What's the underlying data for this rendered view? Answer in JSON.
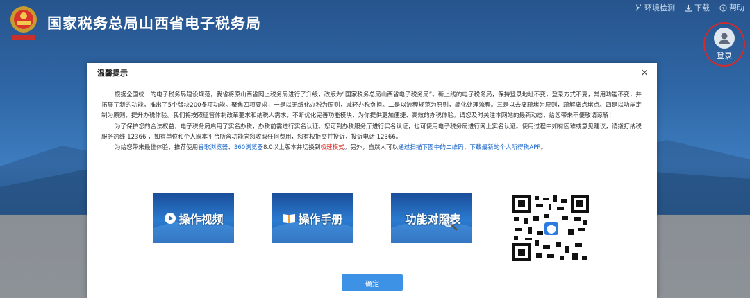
{
  "header": {
    "site_title": "国家税务总局山西省电子税务局",
    "links": [
      {
        "icon": "env-check-icon",
        "label": "环境检测"
      },
      {
        "icon": "download-icon",
        "label": "下载"
      },
      {
        "icon": "help-icon",
        "label": "帮助"
      }
    ],
    "login_label": "登录"
  },
  "modal": {
    "title": "温馨提示",
    "close_glyph": "×",
    "paragraph1": "根据全国统一的电子税务局建设规范，我省将原山西省网上税务局进行了升级，改版为“国家税务总局山西省电子税务局”。新上线的电子税务局，保持登录地址不变，登录方式不变，常用功能不变，并拓展了新的功能，推出了5个版块200多项功能。聚焦四项要求，一是以无纸化办税为原则，减轻办税负担。二是以流程规范为原则，简化处理流程。三是以去痛疏堵为原则，疏解痛点堵点。四是以功能定制为原则，提升办税体验。我们将按照征管体制改革要求和纳税人需求，不断优化完善功能模块，为你提供更加便捷、高效的办税体验。请您及时关注本网站的最新动态，给您带来不便敬请谅解！",
    "paragraph2": "为了保护您的合法权益，电子税务局启用了实名办税，办税前需进行实名认证。您可到办税服务厅进行实名认证，也可使用电子税务局进行网上实名认证。使用过程中如有困难或意见建议，请拨打纳税服务热线 12366 ，如有单位和个人既本平台所含功能向您收取任何费用，您有权拒交并投诉，投诉电话 12366。",
    "paragraph3": {
      "prefix": "为给您带来最佳体验，推荐使用",
      "browser1": "谷歌浏览器",
      "sep": "、",
      "browser2": "360浏览器",
      "mid": "8.0以上版本并切换到",
      "mode": "极速模式",
      "mid2": "。另外，自然人可以",
      "qr_text": "通过扫描下图中的二维码，下载最新的个人所得税APP",
      "suffix": "。"
    },
    "tiles": [
      {
        "icon": "play-icon",
        "label": "操作视频"
      },
      {
        "icon": "book-icon",
        "label": "操作手册"
      },
      {
        "icon": "magnifier-icon",
        "label": "功能对照表"
      }
    ],
    "confirm_label": "确定"
  },
  "colors": {
    "link_blue": "#1a64c8",
    "highlight_red": "#e0201a",
    "confirm_button": "#3d92e6",
    "login_ring": "#d42a2a"
  }
}
